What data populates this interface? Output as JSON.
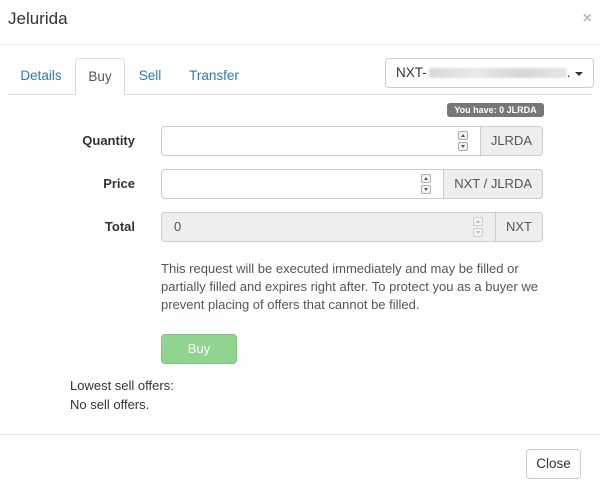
{
  "modal": {
    "title": "Jelurida",
    "close_symbol": "×"
  },
  "tabs": [
    {
      "label": "Details"
    },
    {
      "label": "Buy",
      "active": true
    },
    {
      "label": "Sell"
    },
    {
      "label": "Transfer"
    }
  ],
  "account_select": {
    "prefix": "NXT-",
    "suffix": "."
  },
  "balance_badge": "You have: 0 JLRDA",
  "form": {
    "quantity": {
      "label": "Quantity",
      "value": "",
      "unit": "JLRDA"
    },
    "price": {
      "label": "Price",
      "value": "",
      "unit": "NXT / JLRDA"
    },
    "total": {
      "label": "Total",
      "value": "0",
      "unit": "NXT"
    }
  },
  "info_text": "This request will be executed immediately and may be filled or partially filled and expires right after. To protect you as a buyer we prevent placing of offers that cannot be filled.",
  "buy_button": "Buy",
  "offers": {
    "label": "Lowest sell offers:",
    "value": "No sell offers."
  },
  "footer": {
    "close_label": "Close"
  },
  "colors": {
    "link": "#2a7ab8",
    "buy_button": "#8fd48f",
    "badge": "#777777"
  }
}
